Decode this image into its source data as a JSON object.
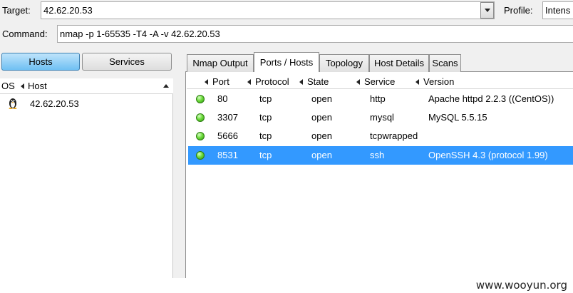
{
  "toolbar": {
    "target_label": "Target:",
    "target_value": "42.62.20.53",
    "profile_label": "Profile:",
    "profile_value": "Intens",
    "command_label": "Command:",
    "command_value": "nmap -p 1-65535 -T4 -A -v 42.62.20.53"
  },
  "left_panel": {
    "buttons": {
      "hosts": "Hosts",
      "services": "Services"
    },
    "columns": {
      "os": "OS",
      "host": "Host"
    },
    "hosts": [
      {
        "address": "42.62.20.53",
        "os_icon": "linux-penguin-icon"
      }
    ]
  },
  "tabs": [
    "Nmap Output",
    "Ports / Hosts",
    "Topology",
    "Host Details",
    "Scans"
  ],
  "active_tab": "Ports / Hosts",
  "ports_table": {
    "columns": {
      "port": "Port",
      "protocol": "Protocol",
      "state": "State",
      "service": "Service",
      "version": "Version"
    },
    "rows": [
      {
        "port": "80",
        "protocol": "tcp",
        "state": "open",
        "service": "http",
        "version": "Apache httpd 2.2.3 ((CentOS))"
      },
      {
        "port": "3307",
        "protocol": "tcp",
        "state": "open",
        "service": "mysql",
        "version": "MySQL 5.5.15"
      },
      {
        "port": "5666",
        "protocol": "tcp",
        "state": "open",
        "service": "tcpwrapped",
        "version": ""
      },
      {
        "port": "8531",
        "protocol": "tcp",
        "state": "open",
        "service": "ssh",
        "version": "OpenSSH 4.3 (protocol 1.99)"
      }
    ],
    "selected_row": 3,
    "status_color_open": "#4ccf2a",
    "selection_color": "#3399ff"
  },
  "watermark": "www.wooyun.org"
}
